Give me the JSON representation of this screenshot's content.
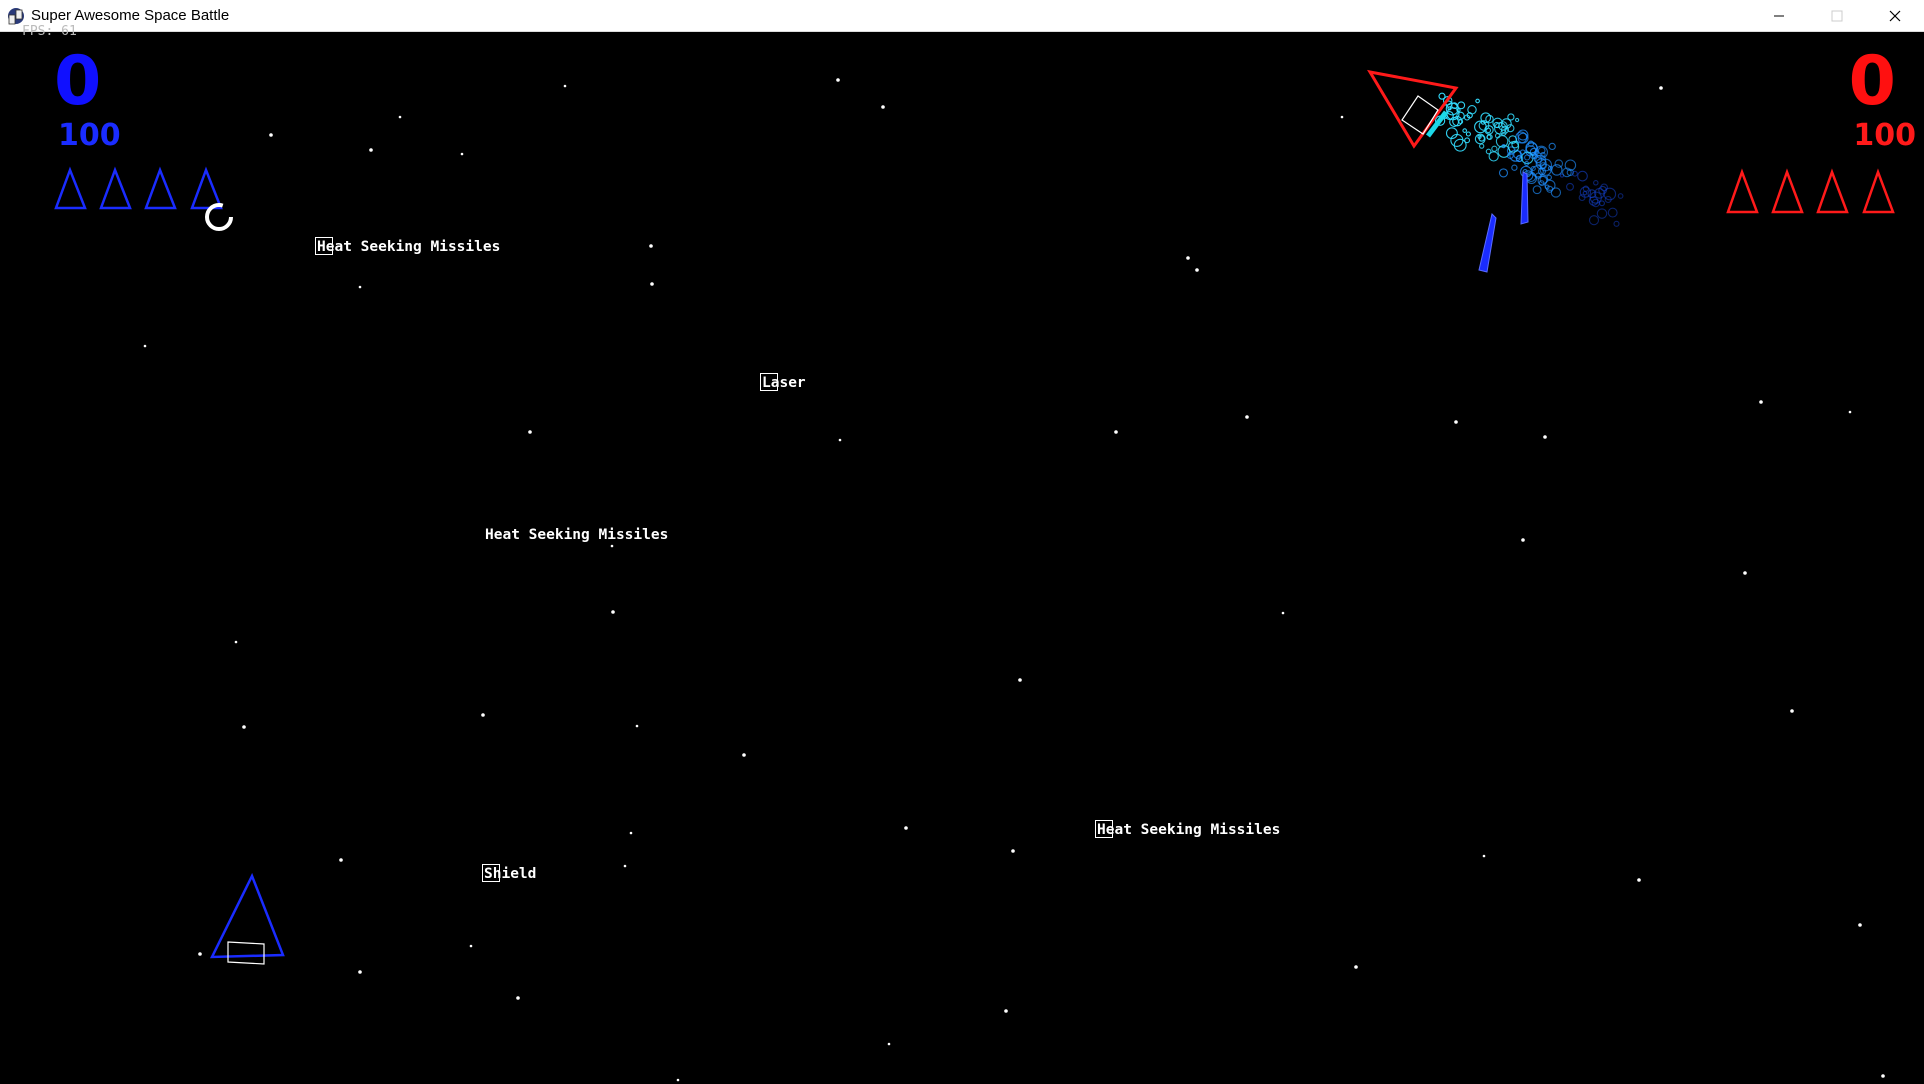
{
  "window": {
    "title": "Super Awesome Space Battle",
    "controls": [
      "minimize-icon",
      "maximize-icon",
      "close-icon"
    ]
  },
  "hud": {
    "fps_label": "FPS: 61",
    "player1": {
      "score": "0",
      "health": "100",
      "lives": 4,
      "color": "#1010ff"
    },
    "player2": {
      "score": "0",
      "health": "100",
      "lives": 4,
      "color": "#ff1010"
    }
  },
  "pickups": [
    {
      "label": "Heat Seeking Missiles"
    },
    {
      "label": "Laser"
    },
    {
      "label": "Heat Seeking Missiles"
    },
    {
      "label": "Shield"
    },
    {
      "label": "Heat Seeking Missiles"
    }
  ],
  "colors": {
    "background": "#000000",
    "player1": "#1a2cff",
    "player2": "#ff1a1a",
    "particles": "#00bfff",
    "pickup_text": "#ffffff"
  }
}
